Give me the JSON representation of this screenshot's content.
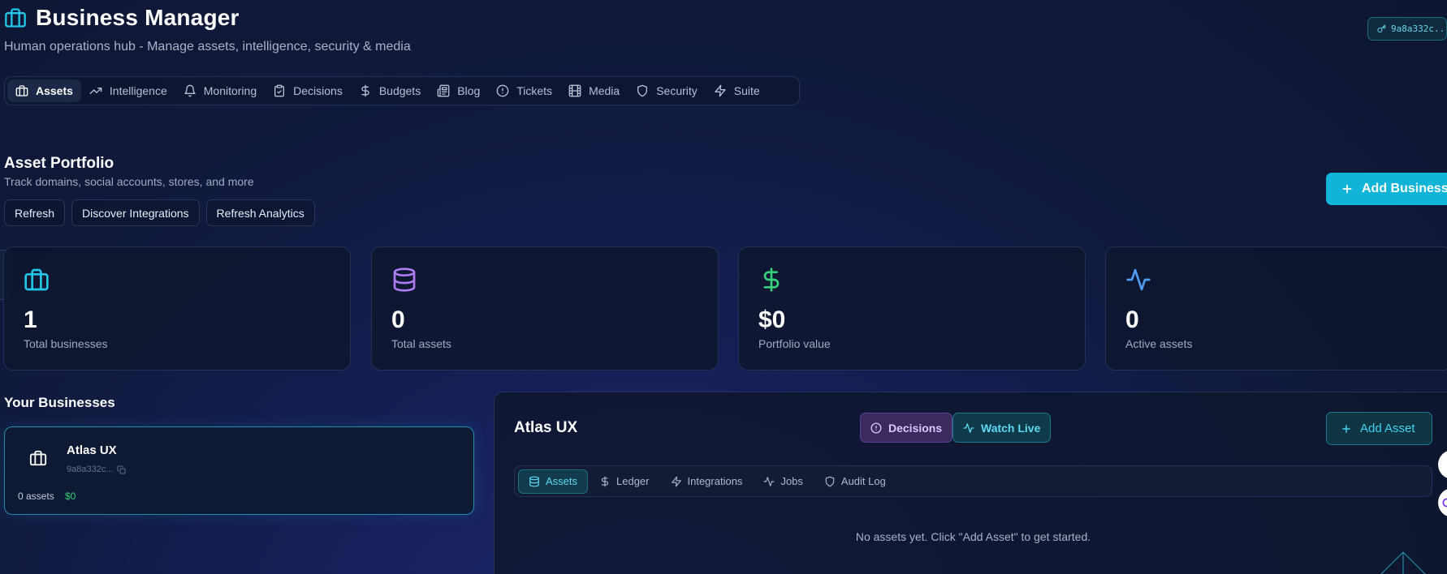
{
  "header": {
    "title": "Business Manager",
    "subtitle": "Human operations hub - Manage assets, intelligence, security & media",
    "key_badge": "9a8a332c..."
  },
  "nav": {
    "items": [
      {
        "label": "Assets",
        "icon": "briefcase-icon",
        "active": true
      },
      {
        "label": "Intelligence",
        "icon": "trending-up-icon"
      },
      {
        "label": "Monitoring",
        "icon": "bell-icon"
      },
      {
        "label": "Decisions",
        "icon": "clipboard-icon"
      },
      {
        "label": "Budgets",
        "icon": "dollar-icon"
      },
      {
        "label": "Blog",
        "icon": "newspaper-icon"
      },
      {
        "label": "Tickets",
        "icon": "alert-circle-icon"
      },
      {
        "label": "Media",
        "icon": "film-icon"
      },
      {
        "label": "Security",
        "icon": "shield-icon"
      },
      {
        "label": "Suite",
        "icon": "zap-icon"
      }
    ]
  },
  "portfolio": {
    "title": "Asset Portfolio",
    "subtitle": "Track domains, social accounts, stores, and more",
    "buttons": {
      "refresh": "Refresh",
      "discover": "Discover Integrations",
      "refresh_analytics": "Refresh Analytics"
    },
    "add_business": "Add Business"
  },
  "stats": [
    {
      "value": "1",
      "label": "Total businesses",
      "icon": "briefcase-icon",
      "color": "#22c7e8"
    },
    {
      "value": "0",
      "label": "Total assets",
      "icon": "database-icon",
      "color": "#b07cf5"
    },
    {
      "value": "$0",
      "label": "Portfolio value",
      "icon": "dollar-icon",
      "color": "#34d17a"
    },
    {
      "value": "0",
      "label": "Active assets",
      "icon": "activity-icon",
      "color": "#4f9df5"
    }
  ],
  "businesses": {
    "title": "Your Businesses",
    "items": [
      {
        "name": "Atlas UX",
        "id": "9a8a332c...",
        "assets": "0 assets",
        "value": "$0"
      }
    ]
  },
  "detail": {
    "title": "Atlas UX",
    "decisions_label": "Decisions",
    "watch_label": "Watch Live",
    "add_asset": "Add Asset",
    "tabs": [
      {
        "label": "Assets",
        "icon": "database-icon",
        "active": true
      },
      {
        "label": "Ledger",
        "icon": "dollar-icon"
      },
      {
        "label": "Integrations",
        "icon": "zap-icon"
      },
      {
        "label": "Jobs",
        "icon": "activity-icon"
      },
      {
        "label": "Audit Log",
        "icon": "shield-icon"
      }
    ],
    "empty_message": "No assets yet. Click \"Add Asset\" to get started."
  },
  "colors": {
    "accent": "#0fb4d8",
    "background": "#111a3f",
    "success": "#34d17a",
    "purple": "#b07cf5"
  }
}
